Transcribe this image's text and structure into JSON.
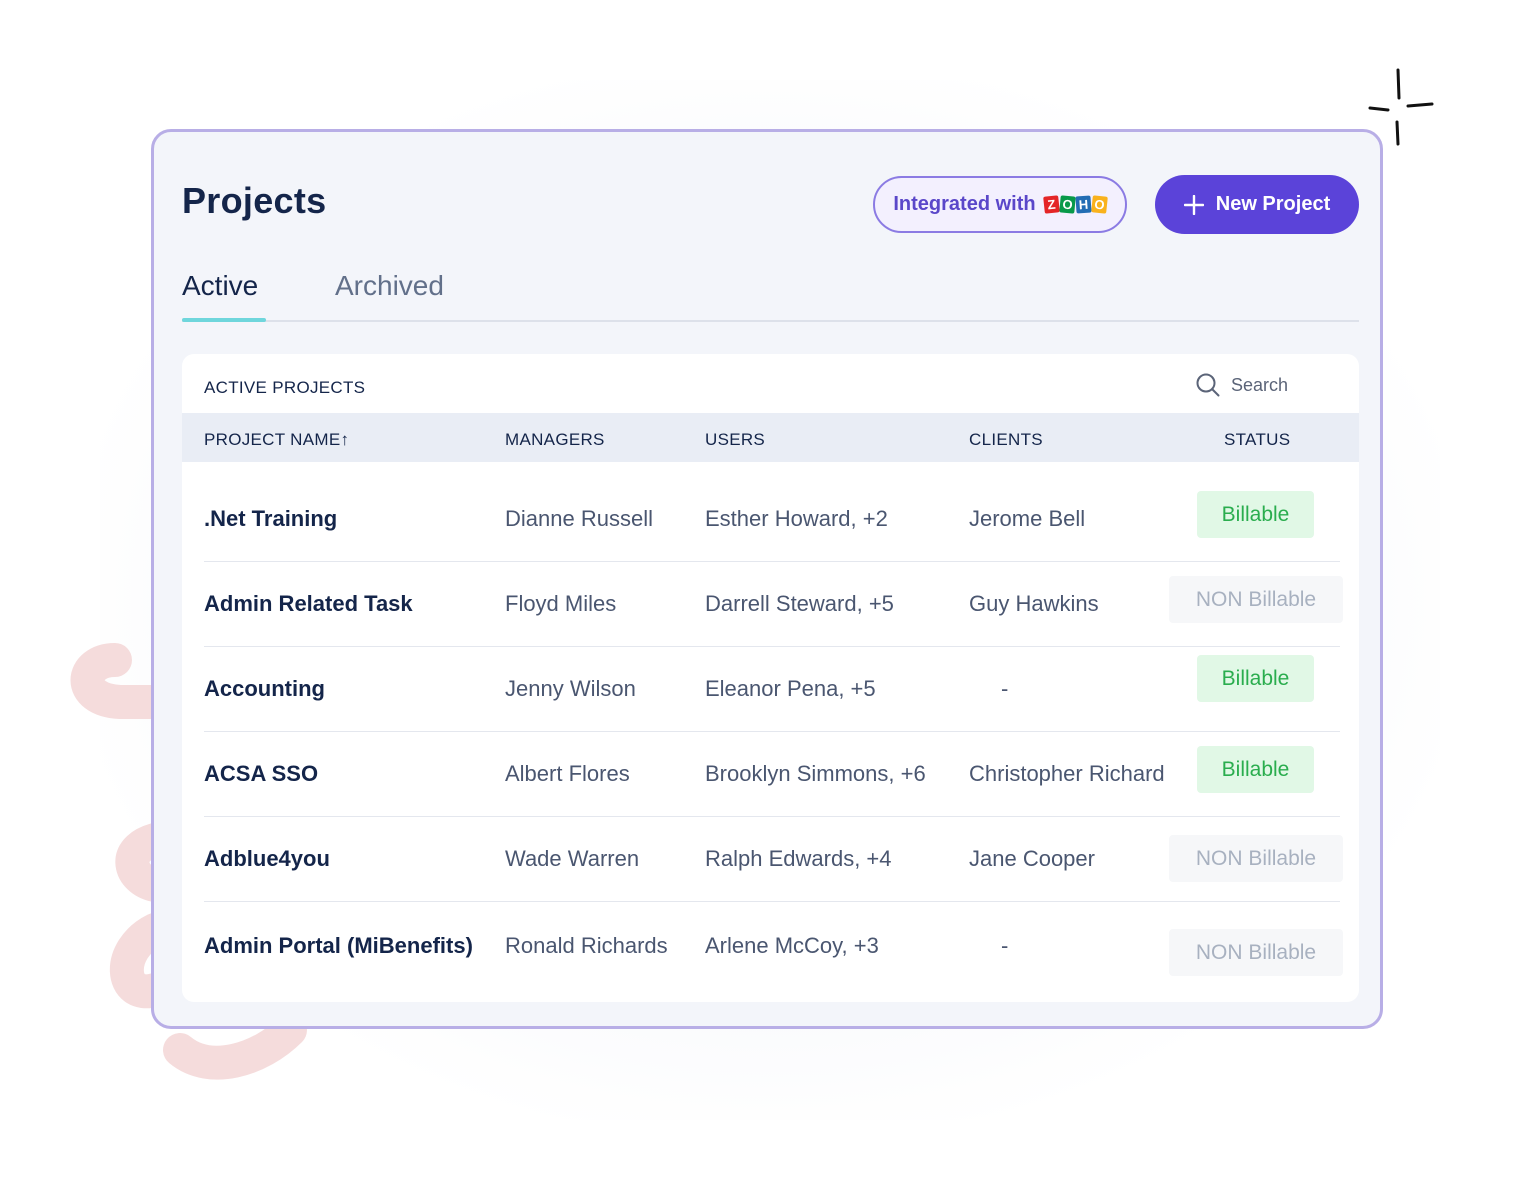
{
  "header": {
    "title": "Projects",
    "integration_prefix": "Integrated with",
    "zoho_letters": [
      "Z",
      "O",
      "H",
      "O"
    ],
    "zoho_colors": [
      "#e42527",
      "#089949",
      "#226db4",
      "#f9b21d"
    ],
    "new_project_label": "New Project"
  },
  "tabs": [
    {
      "label": "Active",
      "active": true
    },
    {
      "label": "Archived",
      "active": false
    }
  ],
  "panel": {
    "title": "ACTIVE PROJECTS",
    "search_placeholder": "Search"
  },
  "columns": [
    "PROJECT NAME↑",
    "MANAGERS",
    "USERS",
    "CLIENTS",
    "STATUS"
  ],
  "rows": [
    {
      "name": ".Net Training",
      "manager": "Dianne Russell",
      "users": "Esther Howard, +2",
      "client": "Jerome Bell",
      "status": "Billable"
    },
    {
      "name": "Admin Related Task",
      "manager": "Floyd Miles",
      "users": "Darrell Steward, +5",
      "client": "Guy Hawkins",
      "status": "NON Billable"
    },
    {
      "name": "Accounting",
      "manager": "Jenny Wilson",
      "users": "Eleanor Pena, +5",
      "client": "-",
      "status": "Billable"
    },
    {
      "name": "ACSA SSO",
      "manager": "Albert Flores",
      "users": "Brooklyn Simmons, +6",
      "client": "Christopher Richard",
      "status": "Billable"
    },
    {
      "name": "Adblue4you",
      "manager": "Wade Warren",
      "users": "Ralph Edwards, +4",
      "client": "Jane Cooper",
      "status": "NON Billable"
    },
    {
      "name": "Admin Portal (MiBenefits)",
      "manager": "Ronald Richards",
      "users": "Arlene McCoy, +3",
      "client": "-",
      "status": "NON Billable"
    }
  ],
  "colors": {
    "accent": "#5b43d9",
    "billable_text": "#2aad4e",
    "billable_bg": "#e1f8e6",
    "non_billable_text": "#a8b1c0",
    "tab_underline": "#6fd6dc"
  }
}
